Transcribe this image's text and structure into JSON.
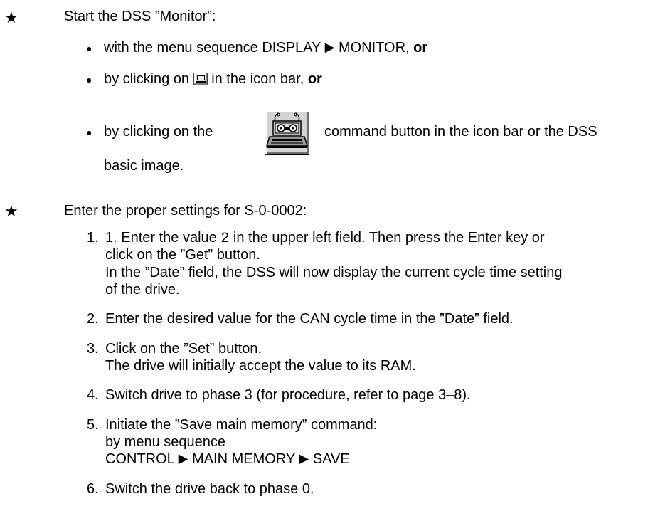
{
  "section1": {
    "star": "★",
    "heading": "Start the DSS ”Monitor”:",
    "bullet_glyph": "●",
    "b1_pre": "with the menu sequence DISPLAY",
    "b1_arrow": "▶",
    "b1_post": "MONITOR,",
    "or": "or",
    "b2_pre": "by clicking on",
    "b2_post": "in the icon bar,",
    "b3_pre": "by clicking on the",
    "b3_post": "command button in the icon bar or the DSS",
    "b3_cont": "basic image."
  },
  "section2": {
    "star": "★",
    "heading": "Enter the proper settings for S-0-0002:",
    "step1_num": "1.",
    "step1_l1_pre": "1. Enter the value",
    "step1_value": "2",
    "step1_l1_post": "in the upper left field. Then press the Enter key or",
    "step1_l2": "click on the ”Get” button.",
    "step1_l3": "In the ”Date” field, the DSS will now display the current cycle time setting",
    "step1_l4": "of the drive.",
    "step2_num": "2.",
    "step2_l1": "Enter the desired value for the CAN cycle time in the ”Date” field.",
    "step3_num": "3.",
    "step3_l1": "Click on the ”Set” button.",
    "step3_l2": "The drive will initially accept the value to its RAM.",
    "step4_num": "4.",
    "step4_l1": "Switch drive to phase 3 (for procedure, refer to page 3–8).",
    "step5_num": "5.",
    "step5_l1": "Initiate the ”Save main memory” command:",
    "step5_l2": "by menu sequence",
    "step5_l3_a": "CONTROL",
    "step5_l3_b": "MAIN MEMORY",
    "step5_l3_c": "SAVE",
    "arrow": "▶",
    "step6_num": "6.",
    "step6_l1": "Switch the drive back to phase 0."
  }
}
